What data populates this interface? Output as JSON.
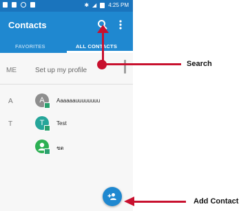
{
  "status_bar": {
    "time": "4:25 PM"
  },
  "app_bar": {
    "title": "Contacts",
    "search_icon": "search-icon",
    "more_icon": "more-vert-icon",
    "color": "#1f88d0"
  },
  "tabs": [
    {
      "label": "FAVORITES",
      "selected": false
    },
    {
      "label": "ALL CONTACTS",
      "selected": true
    }
  ],
  "profile_row": {
    "section": "ME",
    "text": "Set up my profile"
  },
  "contacts": [
    {
      "section": "A",
      "initial": "A",
      "name": "Aaaaaauuuuuuuu",
      "avatar_color": "#8e8e8e"
    },
    {
      "section": "T",
      "initial": "T",
      "name": "Test",
      "avatar_color": "#26a69a"
    },
    {
      "section": "",
      "initial": "",
      "name": "ชต",
      "avatar_color": "#2db053"
    }
  ],
  "fab": {
    "icon": "add-contact-icon"
  },
  "annotations": [
    {
      "label": "Search"
    },
    {
      "label": "Add Contact"
    }
  ],
  "annotation_color": "#c8102e"
}
